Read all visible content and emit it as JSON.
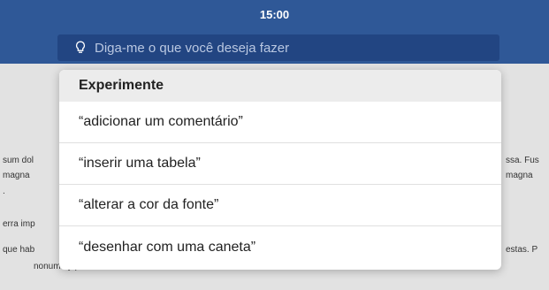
{
  "status_bar": {
    "time": "15:00"
  },
  "search": {
    "placeholder": "Diga-me o que você deseja fazer",
    "icon": "lightbulb-icon"
  },
  "suggestions": {
    "header": "Experimente",
    "items": [
      "“adicionar um comentário”",
      "“inserir uma tabela”",
      "“alterar a cor da fonte”",
      "“desenhar com uma caneta”"
    ]
  },
  "document_snippets": {
    "left": [
      "sum dol",
      "magna",
      ".",
      "erra imp",
      "que hab",
      "nonummy pede. Mauris et orci."
    ],
    "right": [
      "ssa. Fus",
      "magna",
      "estas. P"
    ]
  },
  "colors": {
    "header_bg": "#2f5897",
    "search_bg": "#224582",
    "panel_bg": "#ffffff",
    "panel_header_bg": "#ececec"
  }
}
